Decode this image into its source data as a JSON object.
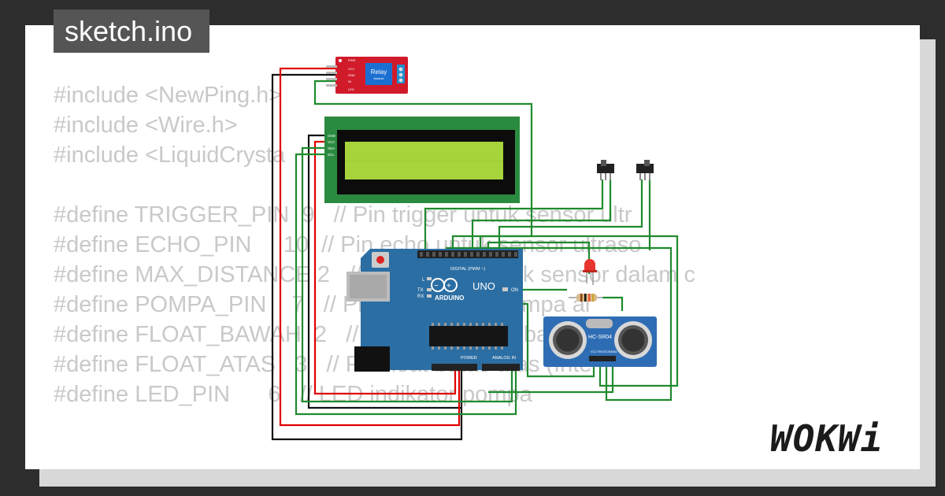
{
  "header": {
    "title": "sketch.ino"
  },
  "code_lines": [
    "#include <NewPing.h>",
    "#include <Wire.h>",
    "#include <LiquidCrysta",
    "",
    "#define TRIGGER_PIN  9   // Pin trigger untuk sensor ultr",
    "#define ECHO_PIN     10  // Pin echo untuk sensor ultraso",
    "#define MAX_DISTANCE 2   // Maksimum jarak sensor dalam c",
    "#define POMPA_PIN    7   // Pin pengontrol pompa ai",
    "#define FLOAT_BAWAH  2   // Pin float switch bawah (Int",
    "#define FLOAT_ATAS   3   // Pin float batas atas (Inte",
    "#define LED_PIN      6   // LED indikator pompa"
  ],
  "relay": {
    "label_main": "Relay",
    "label_sub": "Module",
    "pins": [
      "PWR",
      "VCC",
      "GND",
      "IN",
      "LED"
    ]
  },
  "lcd": {
    "pins": [
      "GND",
      "VCC",
      "SDA",
      "SCL"
    ]
  },
  "arduino": {
    "brand": "ARDUINO",
    "model": "UNO",
    "digital_label": "DIGITAL (PWM ~)",
    "power_label": "POWER",
    "analog_label": "ANALOG IN",
    "led_l": "L",
    "led_tx": "TX",
    "led_rx": "RX",
    "led_on": "ON",
    "digital_pins": [
      "AREF",
      "GND",
      "13",
      "12",
      "~11",
      "~10",
      "~9",
      "8",
      "7",
      "~6",
      "~5",
      "4",
      "~3",
      "2",
      "TX→1",
      "RX←0"
    ],
    "power_pins": [
      "IOREF",
      "RESET",
      "3.3V",
      "5V",
      "GND",
      "GND",
      "Vin"
    ],
    "analog_pins": [
      "A0",
      "A1",
      "A2",
      "A3",
      "A4",
      "A5"
    ]
  },
  "ultrasonic": {
    "label": "HC-SR04",
    "pins": [
      "VCC",
      "TRIG",
      "ECHO",
      "GND"
    ]
  },
  "brand": {
    "logo": "WOKWi"
  },
  "colors": {
    "background": "#2d2d2d",
    "card": "#ffffff",
    "code_text": "#c9c9c9",
    "wire_green": "#1f8a2e",
    "wire_red": "#e00000",
    "wire_black": "#111111",
    "arduino_board": "#2b6ea3",
    "lcd_board": "#2a8a3f",
    "lcd_screen": "#a6d43a",
    "relay_board": "#d11b2b",
    "ultrasonic_board": "#2e6db4"
  }
}
